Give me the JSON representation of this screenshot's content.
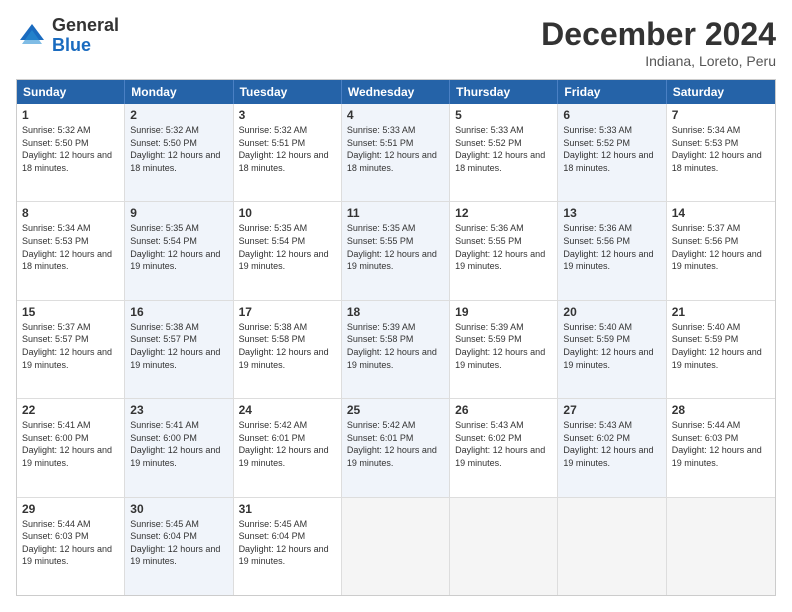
{
  "logo": {
    "general": "General",
    "blue": "Blue"
  },
  "title": "December 2024",
  "location": "Indiana, Loreto, Peru",
  "days_of_week": [
    "Sunday",
    "Monday",
    "Tuesday",
    "Wednesday",
    "Thursday",
    "Friday",
    "Saturday"
  ],
  "weeks": [
    [
      {
        "day": "1",
        "sunrise": "Sunrise: 5:32 AM",
        "sunset": "Sunset: 5:50 PM",
        "daylight": "Daylight: 12 hours and 18 minutes.",
        "empty": false,
        "alt": false
      },
      {
        "day": "2",
        "sunrise": "Sunrise: 5:32 AM",
        "sunset": "Sunset: 5:50 PM",
        "daylight": "Daylight: 12 hours and 18 minutes.",
        "empty": false,
        "alt": true
      },
      {
        "day": "3",
        "sunrise": "Sunrise: 5:32 AM",
        "sunset": "Sunset: 5:51 PM",
        "daylight": "Daylight: 12 hours and 18 minutes.",
        "empty": false,
        "alt": false
      },
      {
        "day": "4",
        "sunrise": "Sunrise: 5:33 AM",
        "sunset": "Sunset: 5:51 PM",
        "daylight": "Daylight: 12 hours and 18 minutes.",
        "empty": false,
        "alt": true
      },
      {
        "day": "5",
        "sunrise": "Sunrise: 5:33 AM",
        "sunset": "Sunset: 5:52 PM",
        "daylight": "Daylight: 12 hours and 18 minutes.",
        "empty": false,
        "alt": false
      },
      {
        "day": "6",
        "sunrise": "Sunrise: 5:33 AM",
        "sunset": "Sunset: 5:52 PM",
        "daylight": "Daylight: 12 hours and 18 minutes.",
        "empty": false,
        "alt": true
      },
      {
        "day": "7",
        "sunrise": "Sunrise: 5:34 AM",
        "sunset": "Sunset: 5:53 PM",
        "daylight": "Daylight: 12 hours and 18 minutes.",
        "empty": false,
        "alt": false
      }
    ],
    [
      {
        "day": "8",
        "sunrise": "Sunrise: 5:34 AM",
        "sunset": "Sunset: 5:53 PM",
        "daylight": "Daylight: 12 hours and 18 minutes.",
        "empty": false,
        "alt": false
      },
      {
        "day": "9",
        "sunrise": "Sunrise: 5:35 AM",
        "sunset": "Sunset: 5:54 PM",
        "daylight": "Daylight: 12 hours and 19 minutes.",
        "empty": false,
        "alt": true
      },
      {
        "day": "10",
        "sunrise": "Sunrise: 5:35 AM",
        "sunset": "Sunset: 5:54 PM",
        "daylight": "Daylight: 12 hours and 19 minutes.",
        "empty": false,
        "alt": false
      },
      {
        "day": "11",
        "sunrise": "Sunrise: 5:35 AM",
        "sunset": "Sunset: 5:55 PM",
        "daylight": "Daylight: 12 hours and 19 minutes.",
        "empty": false,
        "alt": true
      },
      {
        "day": "12",
        "sunrise": "Sunrise: 5:36 AM",
        "sunset": "Sunset: 5:55 PM",
        "daylight": "Daylight: 12 hours and 19 minutes.",
        "empty": false,
        "alt": false
      },
      {
        "day": "13",
        "sunrise": "Sunrise: 5:36 AM",
        "sunset": "Sunset: 5:56 PM",
        "daylight": "Daylight: 12 hours and 19 minutes.",
        "empty": false,
        "alt": true
      },
      {
        "day": "14",
        "sunrise": "Sunrise: 5:37 AM",
        "sunset": "Sunset: 5:56 PM",
        "daylight": "Daylight: 12 hours and 19 minutes.",
        "empty": false,
        "alt": false
      }
    ],
    [
      {
        "day": "15",
        "sunrise": "Sunrise: 5:37 AM",
        "sunset": "Sunset: 5:57 PM",
        "daylight": "Daylight: 12 hours and 19 minutes.",
        "empty": false,
        "alt": false
      },
      {
        "day": "16",
        "sunrise": "Sunrise: 5:38 AM",
        "sunset": "Sunset: 5:57 PM",
        "daylight": "Daylight: 12 hours and 19 minutes.",
        "empty": false,
        "alt": true
      },
      {
        "day": "17",
        "sunrise": "Sunrise: 5:38 AM",
        "sunset": "Sunset: 5:58 PM",
        "daylight": "Daylight: 12 hours and 19 minutes.",
        "empty": false,
        "alt": false
      },
      {
        "day": "18",
        "sunrise": "Sunrise: 5:39 AM",
        "sunset": "Sunset: 5:58 PM",
        "daylight": "Daylight: 12 hours and 19 minutes.",
        "empty": false,
        "alt": true
      },
      {
        "day": "19",
        "sunrise": "Sunrise: 5:39 AM",
        "sunset": "Sunset: 5:59 PM",
        "daylight": "Daylight: 12 hours and 19 minutes.",
        "empty": false,
        "alt": false
      },
      {
        "day": "20",
        "sunrise": "Sunrise: 5:40 AM",
        "sunset": "Sunset: 5:59 PM",
        "daylight": "Daylight: 12 hours and 19 minutes.",
        "empty": false,
        "alt": true
      },
      {
        "day": "21",
        "sunrise": "Sunrise: 5:40 AM",
        "sunset": "Sunset: 5:59 PM",
        "daylight": "Daylight: 12 hours and 19 minutes.",
        "empty": false,
        "alt": false
      }
    ],
    [
      {
        "day": "22",
        "sunrise": "Sunrise: 5:41 AM",
        "sunset": "Sunset: 6:00 PM",
        "daylight": "Daylight: 12 hours and 19 minutes.",
        "empty": false,
        "alt": false
      },
      {
        "day": "23",
        "sunrise": "Sunrise: 5:41 AM",
        "sunset": "Sunset: 6:00 PM",
        "daylight": "Daylight: 12 hours and 19 minutes.",
        "empty": false,
        "alt": true
      },
      {
        "day": "24",
        "sunrise": "Sunrise: 5:42 AM",
        "sunset": "Sunset: 6:01 PM",
        "daylight": "Daylight: 12 hours and 19 minutes.",
        "empty": false,
        "alt": false
      },
      {
        "day": "25",
        "sunrise": "Sunrise: 5:42 AM",
        "sunset": "Sunset: 6:01 PM",
        "daylight": "Daylight: 12 hours and 19 minutes.",
        "empty": false,
        "alt": true
      },
      {
        "day": "26",
        "sunrise": "Sunrise: 5:43 AM",
        "sunset": "Sunset: 6:02 PM",
        "daylight": "Daylight: 12 hours and 19 minutes.",
        "empty": false,
        "alt": false
      },
      {
        "day": "27",
        "sunrise": "Sunrise: 5:43 AM",
        "sunset": "Sunset: 6:02 PM",
        "daylight": "Daylight: 12 hours and 19 minutes.",
        "empty": false,
        "alt": true
      },
      {
        "day": "28",
        "sunrise": "Sunrise: 5:44 AM",
        "sunset": "Sunset: 6:03 PM",
        "daylight": "Daylight: 12 hours and 19 minutes.",
        "empty": false,
        "alt": false
      }
    ],
    [
      {
        "day": "29",
        "sunrise": "Sunrise: 5:44 AM",
        "sunset": "Sunset: 6:03 PM",
        "daylight": "Daylight: 12 hours and 19 minutes.",
        "empty": false,
        "alt": false
      },
      {
        "day": "30",
        "sunrise": "Sunrise: 5:45 AM",
        "sunset": "Sunset: 6:04 PM",
        "daylight": "Daylight: 12 hours and 19 minutes.",
        "empty": false,
        "alt": true
      },
      {
        "day": "31",
        "sunrise": "Sunrise: 5:45 AM",
        "sunset": "Sunset: 6:04 PM",
        "daylight": "Daylight: 12 hours and 19 minutes.",
        "empty": false,
        "alt": false
      },
      {
        "day": "",
        "sunrise": "",
        "sunset": "",
        "daylight": "",
        "empty": true,
        "alt": false
      },
      {
        "day": "",
        "sunrise": "",
        "sunset": "",
        "daylight": "",
        "empty": true,
        "alt": true
      },
      {
        "day": "",
        "sunrise": "",
        "sunset": "",
        "daylight": "",
        "empty": true,
        "alt": false
      },
      {
        "day": "",
        "sunrise": "",
        "sunset": "",
        "daylight": "",
        "empty": true,
        "alt": true
      }
    ]
  ]
}
